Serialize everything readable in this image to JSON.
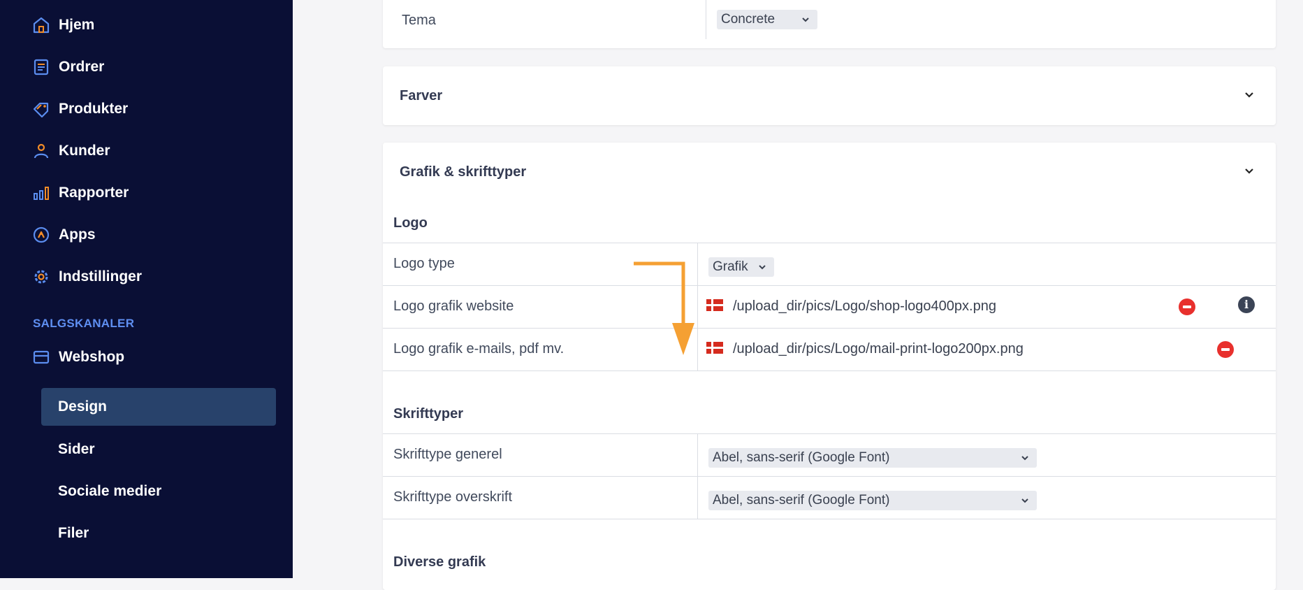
{
  "sidebar": {
    "items": [
      {
        "label": "Hjem",
        "icon": "home-icon"
      },
      {
        "label": "Ordrer",
        "icon": "orders-icon"
      },
      {
        "label": "Produkter",
        "icon": "tag-icon"
      },
      {
        "label": "Kunder",
        "icon": "user-icon"
      },
      {
        "label": "Rapporter",
        "icon": "bar-chart-icon"
      },
      {
        "label": "Apps",
        "icon": "apps-icon"
      },
      {
        "label": "Indstillinger",
        "icon": "gear-icon"
      }
    ],
    "section_label": "SALGSKANALER",
    "channel": {
      "label": "Webshop",
      "icon": "store-icon"
    },
    "sub_items": [
      {
        "label": "Design",
        "active": true
      },
      {
        "label": "Sider",
        "active": false
      },
      {
        "label": "Sociale medier",
        "active": false
      },
      {
        "label": "Filer",
        "active": false
      }
    ]
  },
  "theme_card": {
    "label": "Tema",
    "value": "Concrete"
  },
  "colors_card": {
    "title": "Farver"
  },
  "graphics_card": {
    "title": "Grafik & skrifttyper",
    "logo_group": {
      "title": "Logo",
      "logo_type": {
        "label": "Logo type",
        "value": "Grafik"
      },
      "logo_website": {
        "label": "Logo grafik website",
        "path": "/upload_dir/pics/Logo/shop-logo400px.png"
      },
      "logo_email": {
        "label": "Logo grafik e-mails, pdf mv.",
        "path": "/upload_dir/pics/Logo/mail-print-logo200px.png"
      }
    },
    "fonts_group": {
      "title": "Skrifttyper",
      "general": {
        "label": "Skrifttype generel",
        "value": "Abel, sans-serif (Google Font)"
      },
      "heading": {
        "label": "Skrifttype overskrift",
        "value": "Abel, sans-serif (Google Font)"
      }
    },
    "misc_group": {
      "title": "Diverse grafik"
    }
  },
  "colors": {
    "sidebar_bg": "#0a0f35",
    "icon_blue": "#5b8def",
    "icon_orange": "#f28c28",
    "annotation_arrow": "#f5a033",
    "remove_red": "#e8302d"
  }
}
